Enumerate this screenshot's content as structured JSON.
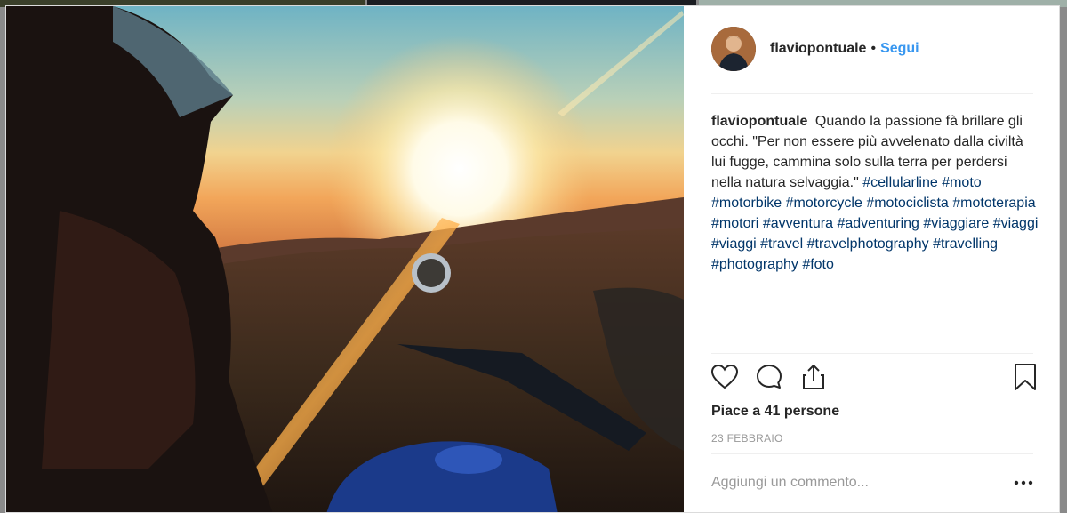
{
  "post": {
    "author": {
      "username": "flaviopontuale",
      "follow_label": "Segui",
      "separator": "•"
    },
    "caption": {
      "username": "flaviopontuale",
      "text": "Quando la passione fà brillare gli occhi. \"Per non essere più avvelenato dalla civiltà lui fugge, cammina solo sulla terra per perdersi nella natura selvaggia.\"",
      "hashtags": [
        "#cellularline",
        "#moto",
        "#motorbike",
        "#motorcycle",
        "#motociclista",
        "#mototerapia",
        "#motori",
        "#avventura",
        "#adventuring",
        "#viaggiare",
        "#viaggi",
        "#viaggi",
        "#travel",
        "#travelphotography",
        "#travelling",
        "#photography",
        "#foto"
      ]
    },
    "actions": {
      "like_icon": "heart-icon",
      "comment_icon": "comment-icon",
      "share_icon": "share-icon",
      "save_icon": "bookmark-icon"
    },
    "likes_text": "Piace a 41 persone",
    "date": "23 FEBBRAIO",
    "comment": {
      "placeholder": "Aggiungi un commento...",
      "more_icon": "more-options-icon"
    }
  },
  "colors": {
    "link_blue": "#3897f0",
    "hashtag": "#003569",
    "text": "#262626",
    "muted": "#999999"
  }
}
